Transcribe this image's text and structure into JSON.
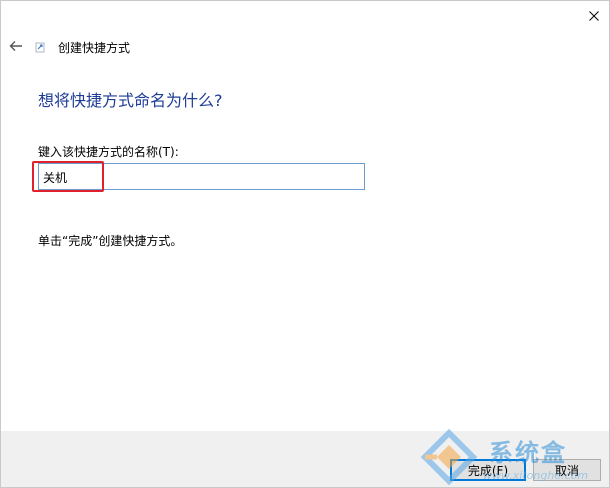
{
  "window": {
    "title": "创建快捷方式"
  },
  "page": {
    "heading": "想将快捷方式命名为什么?",
    "field_label": "键入该快捷方式的名称(T):",
    "name_value": "关机",
    "instruction": "单击“完成”创建快捷方式。"
  },
  "buttons": {
    "finish": "完成(F)",
    "cancel": "取消"
  },
  "watermark": {
    "name": "系统盒",
    "url": "www.xitonghe.com"
  },
  "icons": {
    "back": "back-arrow-icon",
    "close": "close-icon",
    "wizard": "shortcut-wizard-icon"
  },
  "colors": {
    "heading": "#1e3c96",
    "input_border": "#6d9ccf",
    "highlight": "#e0202a",
    "footer": "#f0f0f0",
    "default_button_border": "#0078d7"
  }
}
